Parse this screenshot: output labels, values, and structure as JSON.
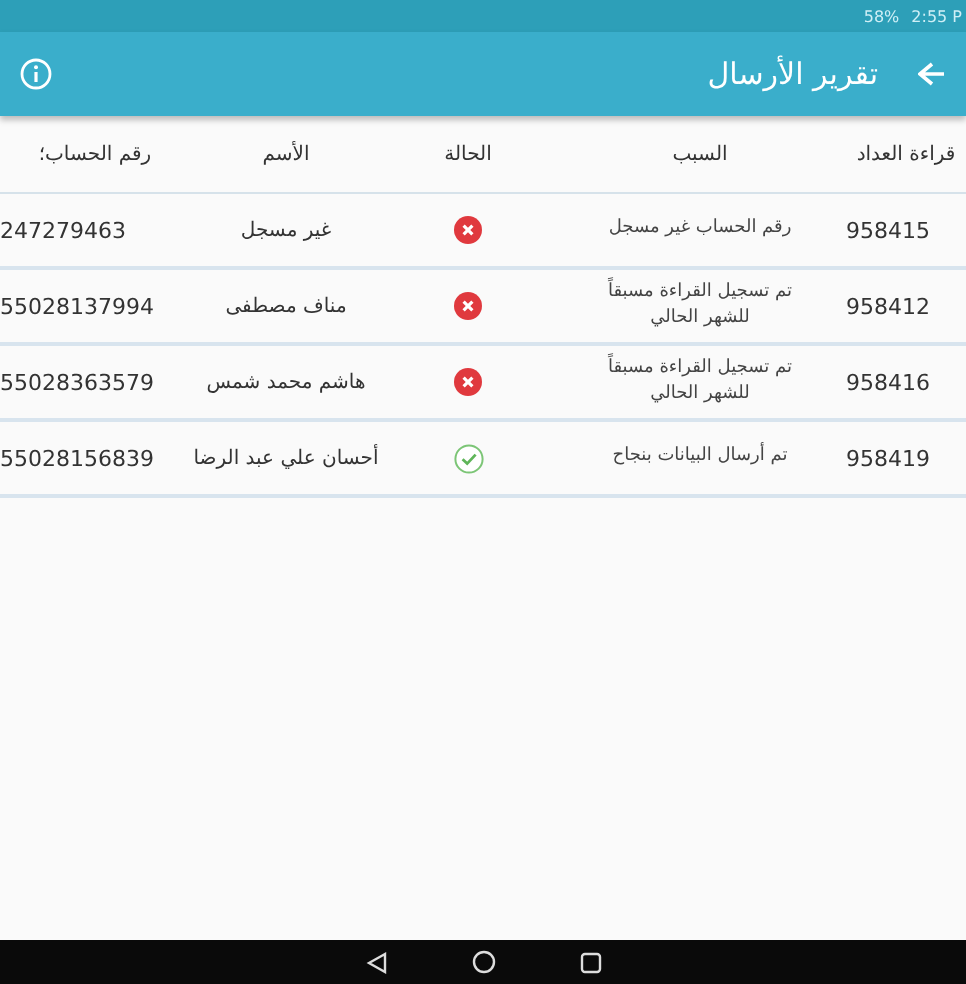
{
  "status_bar": {
    "battery": "58%",
    "time": "2:55 P"
  },
  "app_bar": {
    "title": "تقرير الأرسال"
  },
  "table": {
    "columns": [
      "قراءة العداد",
      "السبب",
      "الحالة",
      "الأسم",
      "رقم الحساب؛"
    ],
    "rows": [
      {
        "reading": "958415",
        "reason": "رقم الحساب غير مسجل",
        "kind": "failed",
        "name": "غير مسجل",
        "account": "247279463"
      },
      {
        "reading": "958412",
        "reason": "تم تسجيل القراءة مسبقاً للشهر الحالي",
        "kind": "failed",
        "name": "مناف مصطفى",
        "account": "55028137994"
      },
      {
        "reading": "958416",
        "reason": "تم تسجيل القراءة مسبقاً للشهر الحالي",
        "kind": "failed",
        "name": "هاشم محمد شمس",
        "account": "55028363579"
      },
      {
        "reading": "958419",
        "reason": "تم أرسال البيانات بنجاح",
        "kind": "success",
        "name": "أحسان علي عبد الرضا",
        "account": "55028156839"
      }
    ]
  }
}
